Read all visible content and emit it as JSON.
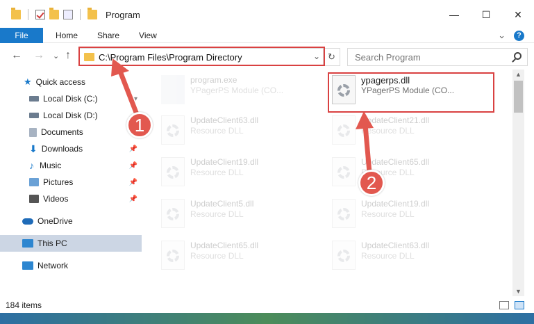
{
  "window": {
    "title": "Program",
    "controls": {
      "minimize": "—",
      "maximize": "☐",
      "close": "✕"
    }
  },
  "ribbon": {
    "tabs": [
      "File",
      "Home",
      "Share",
      "View"
    ],
    "expand_glyph": "⌄",
    "help_glyph": "?"
  },
  "address": {
    "path": "C:\\Program Files\\Program Directory",
    "dropdown_glyph": "⌄",
    "refresh_glyph": "↻"
  },
  "search": {
    "placeholder": "Search Program"
  },
  "nav": {
    "back": "←",
    "forward": "→",
    "recent": "⌄",
    "up": "↑"
  },
  "sidebar": {
    "items": [
      {
        "label": "Quick access",
        "icon": "star-icon",
        "color": "#1979ca",
        "pinned": false
      },
      {
        "label": "Local Disk (C:)",
        "icon": "drive-icon",
        "color": "#6b7c8f",
        "pinned": true
      },
      {
        "label": "Local Disk (D:)",
        "icon": "drive-icon",
        "color": "#6b7c8f",
        "pinned": true
      },
      {
        "label": "Documents",
        "icon": "documents-icon",
        "color": "#a7b3c2",
        "pinned": true
      },
      {
        "label": "Downloads",
        "icon": "download-icon",
        "color": "#1979ca",
        "pinned": true
      },
      {
        "label": "Music",
        "icon": "music-icon",
        "color": "#1979ca",
        "pinned": true
      },
      {
        "label": "Pictures",
        "icon": "pictures-icon",
        "color": "#6aa1d6",
        "pinned": true
      },
      {
        "label": "Videos",
        "icon": "videos-icon",
        "color": "#555555",
        "pinned": true
      },
      {
        "label": "OneDrive",
        "icon": "cloud-icon",
        "color": "#1f6bb8",
        "pinned": false
      },
      {
        "label": "This PC",
        "icon": "computer-icon",
        "color": "#2d86d0",
        "pinned": false
      },
      {
        "label": "Network",
        "icon": "network-icon",
        "color": "#2d86d0",
        "pinned": false
      }
    ],
    "pin_glyph": "📌"
  },
  "files": [
    {
      "name": "program.exe",
      "type": "YPagerPS Module (CO...",
      "faded": true
    },
    {
      "name": "ypagerps.dll",
      "type": "YPagerPS Module (CO...",
      "faded": false
    },
    {
      "name": "UpdateClient63.dll",
      "type": "Resource DLL",
      "faded": true
    },
    {
      "name": "UpdateClient21.dll",
      "type": "Resource DLL",
      "faded": true
    },
    {
      "name": "UpdateClient19.dll",
      "type": "Resource DLL",
      "faded": true
    },
    {
      "name": "UpdateClient65.dll",
      "type": "Resource DLL",
      "faded": true
    },
    {
      "name": "UpdateClient5.dll",
      "type": "Resource DLL",
      "faded": true
    },
    {
      "name": "UpdateClient19.dll",
      "type": "Resource DLL",
      "faded": true
    },
    {
      "name": "UpdateClient65.dll",
      "type": "Resource DLL",
      "faded": true
    },
    {
      "name": "UpdateClient63.dll",
      "type": "Resource DLL",
      "faded": true
    }
  ],
  "status": {
    "item_count": "184 items"
  },
  "callouts": {
    "one": "1",
    "two": "2"
  },
  "colors": {
    "accent": "#1979ca",
    "callout": "#e2584f",
    "highlight": "#d94141"
  }
}
